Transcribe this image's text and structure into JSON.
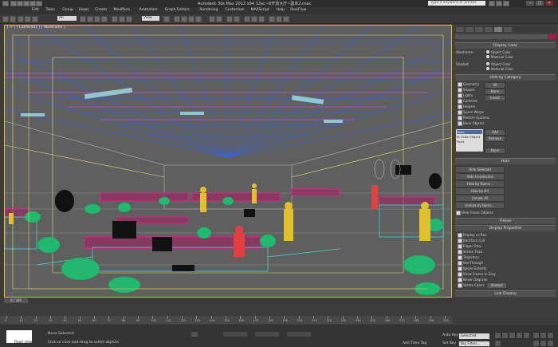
{
  "app": {
    "title": "Autodesk 3ds Max  2012 x64     12ac~8开放大厅~副本2.max",
    "search_placeholder": "Type a keyword or phrase"
  },
  "menus": [
    "Edit",
    "Tools",
    "Group",
    "Views",
    "Create",
    "Modifiers",
    "Animation",
    "Graph Editors",
    "Rendering",
    "Customize",
    "MAXScript",
    "Help",
    "RealFlow"
  ],
  "toolbar": {
    "selection_filter": "All",
    "ref_coord": "View"
  },
  "viewport": {
    "label": "[ + ] [ Camera01 ] [ Wireframe ]",
    "mode_label": "Wireframe"
  },
  "panel": {
    "display_color": {
      "title": "Display Color",
      "wireframe_label": "Wireframe:",
      "shaded_label": "Shaded:",
      "object_color": "Object Color",
      "material_color": "Material Color"
    },
    "hide_by_category": {
      "title": "Hide by Category",
      "items": [
        "Geometry",
        "Shapes",
        "Lights",
        "Cameras",
        "Helpers",
        "Space Warps",
        "Particle Systems",
        "Bone Objects"
      ],
      "btn_all": "All",
      "btn_none": "None",
      "btn_invert": "Invert",
      "list_items": [
        "Bone",
        "IK Chain Object",
        "Point"
      ],
      "btn_add": "Add",
      "btn_remove": "Remove",
      "btn_none2": "None"
    },
    "hide": {
      "title": "Hide",
      "buttons": [
        "Hide Selected",
        "Hide Unselected",
        "Hide by Name...",
        "Hide by Hit",
        "Unhide All",
        "Unhide by Name..."
      ],
      "hide_frozen": "Hide Frozen Objects"
    },
    "freeze_title": "Freeze",
    "display_properties": {
      "title": "Display Properties",
      "items": [
        "Display as Box",
        "Backface Cull",
        "Edges Only",
        "Vertex Ticks",
        "Trajectory",
        "See-Through",
        "Ignore Extents",
        "Show Frozen in Gray",
        "Never Degrade",
        "Vertex Colors"
      ],
      "btn_shaded": "Shaded"
    },
    "link_display": "Link Display"
  },
  "timeline": {
    "slider_label": "0 / 300",
    "ticks": [
      "0",
      "10",
      "20",
      "30",
      "40",
      "50",
      "60",
      "70",
      "80",
      "90",
      "100",
      "110",
      "120",
      "130",
      "140",
      "150",
      "160",
      "170",
      "180",
      "190",
      "200",
      "210",
      "220",
      "230",
      "240",
      "250",
      "260",
      "270",
      "280",
      "290",
      "300"
    ]
  },
  "status": {
    "maxscript_text": "Flood_clear",
    "selection": "None Selected",
    "prompt": "Click or click-and-drag to select objects",
    "add_time_tag": "Add Time Tag",
    "auto_key": "Auto Key",
    "set_key": "Set Key",
    "selected_dropdown": "Selected",
    "key_filters": "Key Filters..."
  },
  "colors": {
    "viewport_border": "#f2c01a",
    "accent": "#c0104a"
  }
}
